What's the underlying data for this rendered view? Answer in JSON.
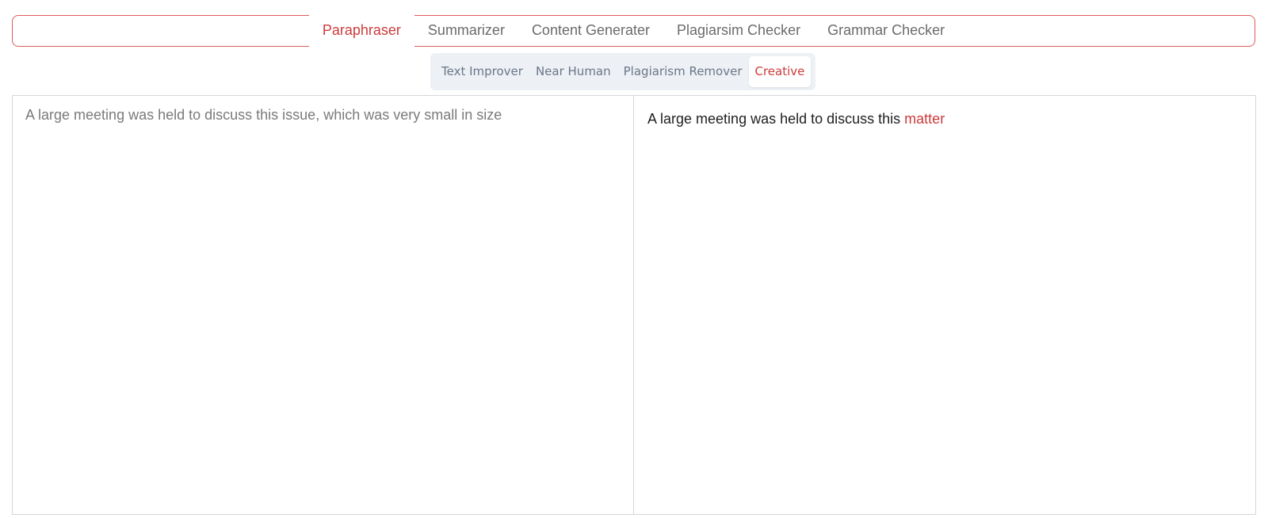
{
  "top_tabs": [
    {
      "label": "Paraphraser",
      "active": true
    },
    {
      "label": "Summarizer",
      "active": false
    },
    {
      "label": "Content Generater",
      "active": false
    },
    {
      "label": "Plagiarsim Checker",
      "active": false
    },
    {
      "label": "Grammar Checker",
      "active": false
    }
  ],
  "modes": [
    {
      "label": "Text Improver",
      "active": false
    },
    {
      "label": "Near Human",
      "active": false
    },
    {
      "label": "Plagiarism Remover",
      "active": false
    },
    {
      "label": "Creative",
      "active": true
    }
  ],
  "input": {
    "value": "A large meeting was held to discuss this issue, which was very small in size"
  },
  "output": {
    "prefix": "A large meeting was held to discuss this ",
    "changed_word": "matter"
  },
  "colors": {
    "accent": "#cc3b3b",
    "tab_text": "#6b6b6b",
    "mode_bg": "#edf1f5",
    "mode_text": "#6b7688",
    "border": "#d6d6d6"
  }
}
